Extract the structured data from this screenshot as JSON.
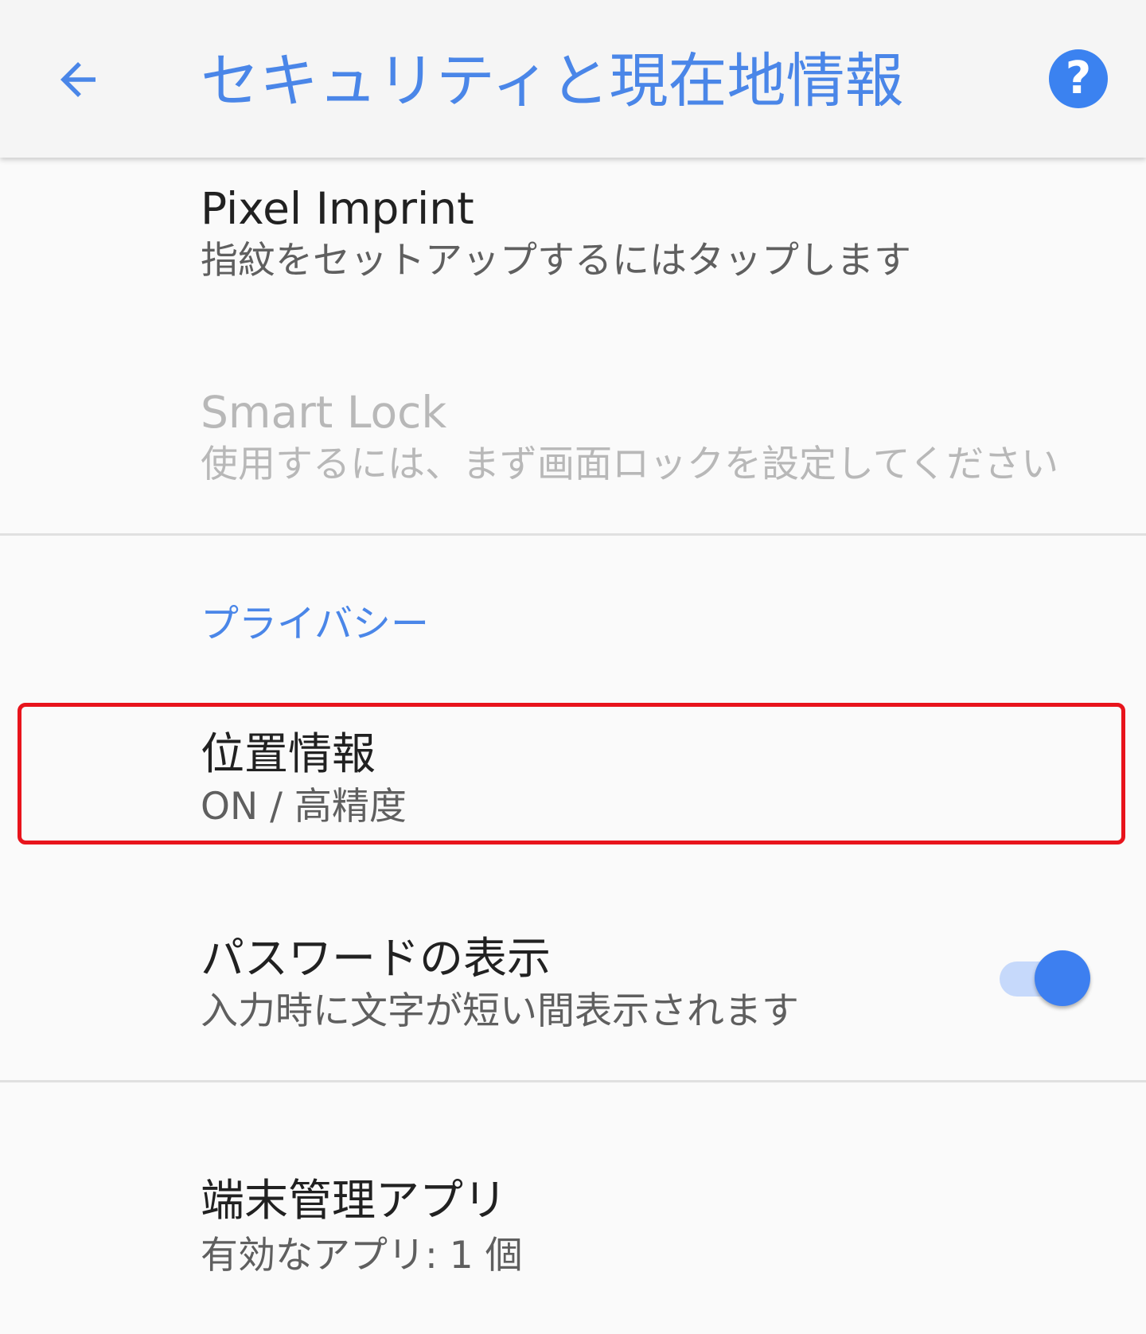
{
  "appbar": {
    "title": "セキュリティと現在地情報",
    "back_icon": "arrow-left-icon",
    "help_icon": "help-circle-icon",
    "help_glyph": "?"
  },
  "items": {
    "pixel_imprint": {
      "title": "Pixel Imprint",
      "subtitle": "指紋をセットアップするにはタップします"
    },
    "smart_lock": {
      "title": "Smart Lock",
      "subtitle": "使用するには、まず画面ロックを設定してください"
    },
    "location": {
      "title": "位置情報",
      "subtitle": "ON / 高精度"
    },
    "show_passwords": {
      "title": "パスワードの表示",
      "subtitle": "入力時に文字が短い間表示されます",
      "toggle_on": true
    },
    "device_admin": {
      "title": "端末管理アプリ",
      "subtitle": "有効なアプリ: 1 個"
    }
  },
  "sections": {
    "privacy": "プライバシー"
  },
  "colors": {
    "accent": "#4a86e8",
    "highlight": "#e8141c",
    "toggle_thumb": "#3d7ff0",
    "toggle_track": "#c6d9fb"
  }
}
